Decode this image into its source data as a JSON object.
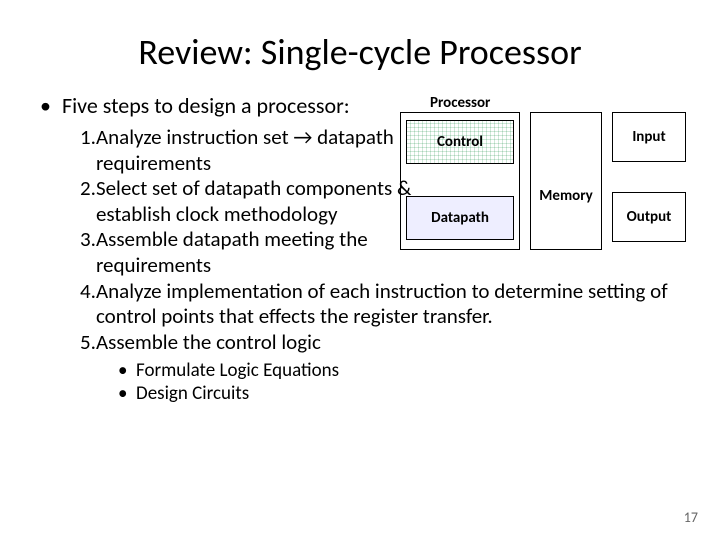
{
  "title": "Review: Single-cycle Processor",
  "intro": "Five steps to design a processor:",
  "steps": {
    "s1num": "1. ",
    "s1": "Analyze instruction set → datapath requirements",
    "s2num": "2. ",
    "s2": "Select set of datapath components & establish clock methodology",
    "s3num": "3. ",
    "s3": "Assemble datapath meeting the requirements",
    "s4num": "4. ",
    "s4": "Analyze implementation of each instruction to determine setting of control points that effects the register transfer.",
    "s5num": "5. ",
    "s5": "Assemble the control logic"
  },
  "sub": {
    "a": "Formulate Logic Equations",
    "b": "Design Circuits"
  },
  "diagram": {
    "processor": "Processor",
    "control": "Control",
    "datapath": "Datapath",
    "memory": "Memory",
    "input": "Input",
    "output": "Output"
  },
  "pagenum": "17"
}
